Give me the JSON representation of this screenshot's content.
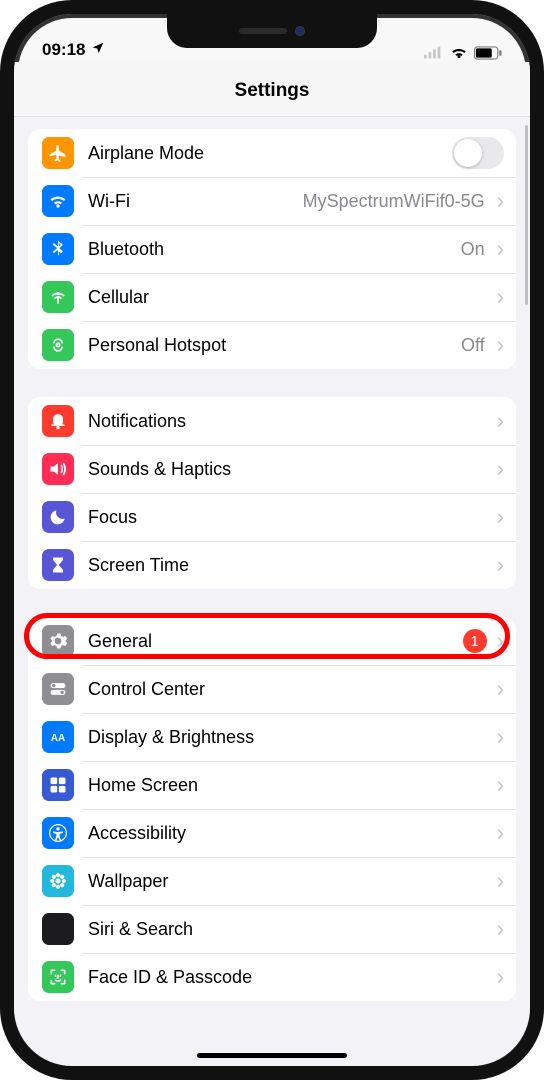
{
  "status": {
    "time": "09:18",
    "location_icon": "location-arrow"
  },
  "title": "Settings",
  "groups": [
    {
      "rows": [
        {
          "id": "airplane",
          "icon": "airplane-icon",
          "bg": "#ff9500",
          "label": "Airplane Mode",
          "toggle": false
        },
        {
          "id": "wifi",
          "icon": "wifi-icon",
          "bg": "#007aff",
          "label": "Wi-Fi",
          "value": "MySpectrumWiFif0-5G",
          "chevron": true
        },
        {
          "id": "bluetooth",
          "icon": "bluetooth-icon",
          "bg": "#007aff",
          "label": "Bluetooth",
          "value": "On",
          "chevron": true
        },
        {
          "id": "cellular",
          "icon": "cellular-icon",
          "bg": "#34c759",
          "label": "Cellular",
          "chevron": true
        },
        {
          "id": "hotspot",
          "icon": "hotspot-icon",
          "bg": "#34c759",
          "label": "Personal Hotspot",
          "value": "Off",
          "chevron": true
        }
      ]
    },
    {
      "rows": [
        {
          "id": "notifications",
          "icon": "bell-icon",
          "bg": "#ff3b30",
          "label": "Notifications",
          "chevron": true
        },
        {
          "id": "sounds",
          "icon": "speaker-icon",
          "bg": "#ff2d55",
          "label": "Sounds & Haptics",
          "chevron": true
        },
        {
          "id": "focus",
          "icon": "moon-icon",
          "bg": "#5856d6",
          "label": "Focus",
          "chevron": true
        },
        {
          "id": "screentime",
          "icon": "hourglass-icon",
          "bg": "#5856d6",
          "label": "Screen Time",
          "chevron": true
        }
      ]
    },
    {
      "rows": [
        {
          "id": "general",
          "icon": "gear-icon",
          "bg": "#8e8e93",
          "label": "General",
          "badge": "1",
          "chevron": true,
          "highlighted": true
        },
        {
          "id": "controlcenter",
          "icon": "switches-icon",
          "bg": "#8e8e93",
          "label": "Control Center",
          "chevron": true
        },
        {
          "id": "display",
          "icon": "aa-icon",
          "bg": "#007aff",
          "label": "Display & Brightness",
          "chevron": true
        },
        {
          "id": "homescreen",
          "icon": "grid-icon",
          "bg": "#3759d2",
          "label": "Home Screen",
          "chevron": true
        },
        {
          "id": "accessibility",
          "icon": "accessibility-icon",
          "bg": "#007aff",
          "label": "Accessibility",
          "chevron": true
        },
        {
          "id": "wallpaper",
          "icon": "flower-icon",
          "bg": "#23b9de",
          "label": "Wallpaper",
          "chevron": true
        },
        {
          "id": "siri",
          "icon": "siri-icon",
          "bg": "#1c1c1e",
          "label": "Siri & Search",
          "chevron": true
        },
        {
          "id": "faceid",
          "icon": "faceid-icon",
          "bg": "#34c759",
          "label": "Face ID & Passcode",
          "chevron": true
        }
      ]
    }
  ]
}
